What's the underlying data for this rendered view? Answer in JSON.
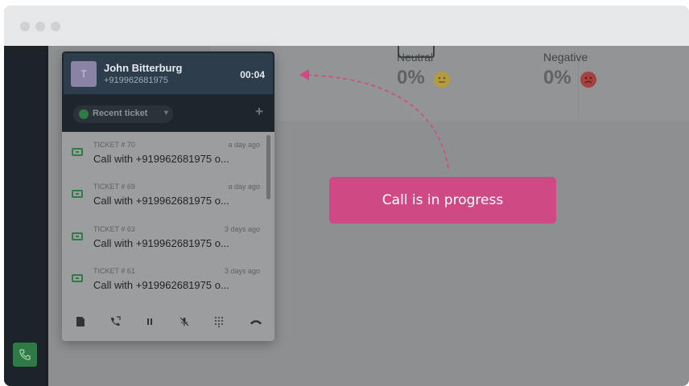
{
  "window": {
    "controls": [
      "close",
      "minimize",
      "maximize"
    ]
  },
  "sentiment": {
    "neutral": {
      "label": "Neutral",
      "value": "0%",
      "icon": "neutral-face-icon"
    },
    "negative": {
      "label": "Negative",
      "value": "0%",
      "icon": "sad-face-icon"
    }
  },
  "call": {
    "avatar_initial": "T",
    "caller_name": "John Bitterburg",
    "caller_number": "+919962681975",
    "timer": "00:04"
  },
  "toolbar": {
    "recent_label": "Recent ticket",
    "add_label": "+"
  },
  "tickets": [
    {
      "id": "TICKET # 70",
      "time": "a day ago",
      "title": "Call with +919962681975 o..."
    },
    {
      "id": "TICKET # 69",
      "time": "a day ago",
      "title": "Call with +919962681975 o..."
    },
    {
      "id": "TICKET # 63",
      "time": "3 days ago",
      "title": "Call with +919962681975 o..."
    },
    {
      "id": "TICKET # 61",
      "time": "3 days ago",
      "title": "Call with +919962681975 o..."
    }
  ],
  "footer_icons": [
    "notes-icon",
    "transfer-call-icon",
    "pause-icon",
    "mute-icon",
    "keypad-icon",
    "hang-up-icon"
  ],
  "tooltip": {
    "text": "Call is in progress"
  },
  "colors": {
    "accent": "#cf4a85",
    "header": "#2d3d4b",
    "green": "#2f7a45",
    "sidebar": "#1b2329"
  }
}
